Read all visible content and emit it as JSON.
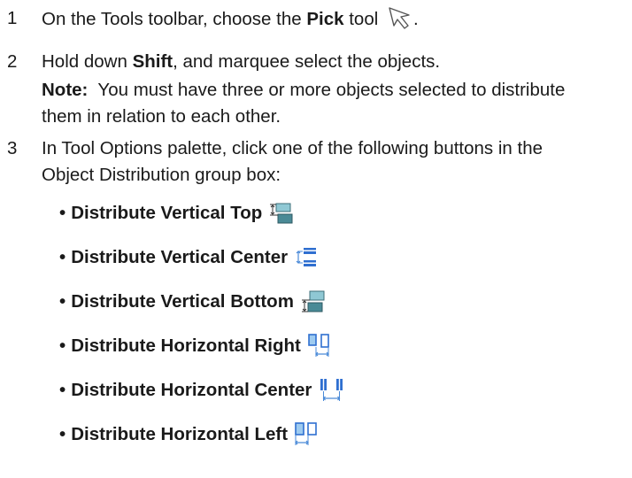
{
  "steps": [
    {
      "num": "1",
      "prefix": "On the Tools toolbar, choose the ",
      "bold": "Pick",
      "suffix": " tool",
      "end": ".",
      "icon": "pick-tool-arrow-icon"
    },
    {
      "num": "2",
      "prefix": "Hold down ",
      "bold": "Shift",
      "suffix": ", and marquee select the objects."
    },
    {
      "num": "3",
      "line1": "In Tool Options palette, click one of the following buttons in the",
      "line2": "Object Distribution group box:"
    }
  ],
  "note": {
    "label": "Note:",
    "line1": "  You must have three or more objects selected to distribute",
    "line2": "them in relation to each other."
  },
  "bullets": [
    {
      "label": "Distribute Vertical Top",
      "icon": "distribute-vertical-top-icon"
    },
    {
      "label": "Distribute Vertical Center",
      "icon": "distribute-vertical-center-icon"
    },
    {
      "label": "Distribute Vertical Bottom",
      "icon": "distribute-vertical-bottom-icon"
    },
    {
      "label": "Distribute Horizontal Right",
      "icon": "distribute-horizontal-right-icon"
    },
    {
      "label": "Distribute Horizontal Center",
      "icon": "distribute-horizontal-center-icon"
    },
    {
      "label": "Distribute Horizontal Left",
      "icon": "distribute-horizontal-left-icon"
    }
  ],
  "bullet_char": "•",
  "colors": {
    "icon_dark": "#4a8a96",
    "icon_light": "#8fc8d4",
    "icon_blue": "#2f6fd0",
    "icon_sky": "#9ecbf0"
  }
}
